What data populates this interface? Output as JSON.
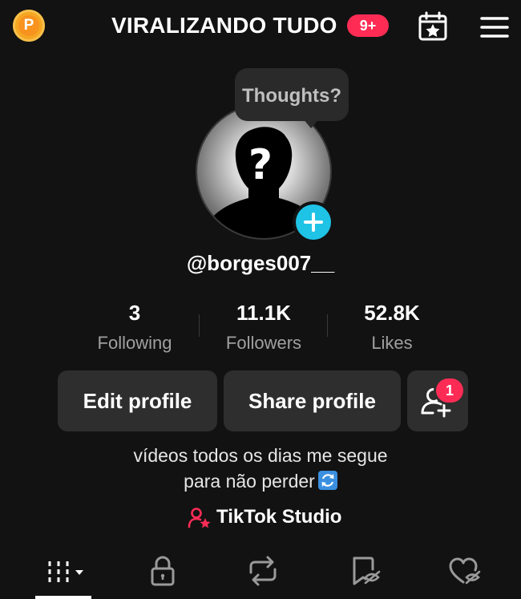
{
  "header": {
    "coin_letter": "P",
    "title": "VIRALIZANDO TUDO",
    "notification_badge": "9+",
    "icons": [
      "coin-icon",
      "calendar-star-icon",
      "menu-icon"
    ]
  },
  "avatar": {
    "thought_bubble": "Thoughts?",
    "icons": [
      "avatar-placeholder",
      "add-photo-icon"
    ]
  },
  "profile": {
    "username": "@borges007__"
  },
  "stats": [
    {
      "value": "3",
      "label": "Following"
    },
    {
      "value": "11.1K",
      "label": "Followers"
    },
    {
      "value": "52.8K",
      "label": "Likes"
    }
  ],
  "actions": {
    "edit_label": "Edit profile",
    "share_label": "Share profile",
    "add_friend_badge": "1"
  },
  "bio": {
    "line1": "vídeos todos os dias me segue",
    "line2": "para não perder",
    "emoji": "sync-emoji"
  },
  "studio": {
    "label": "TikTok Studio"
  },
  "tabs": [
    {
      "icon": "grid-dropdown-icon",
      "selected": true
    },
    {
      "icon": "lock-icon",
      "selected": false
    },
    {
      "icon": "repost-icon",
      "selected": false
    },
    {
      "icon": "bookmark-hidden-icon",
      "selected": false
    },
    {
      "icon": "heart-hidden-icon",
      "selected": false
    }
  ],
  "colors": {
    "background": "#121212",
    "accent_red": "#fe2c55",
    "accent_cyan": "#1fc3e6",
    "coin": "#f7931e",
    "button_bg": "#2e2e2e",
    "muted_text": "#a0a0a0"
  }
}
